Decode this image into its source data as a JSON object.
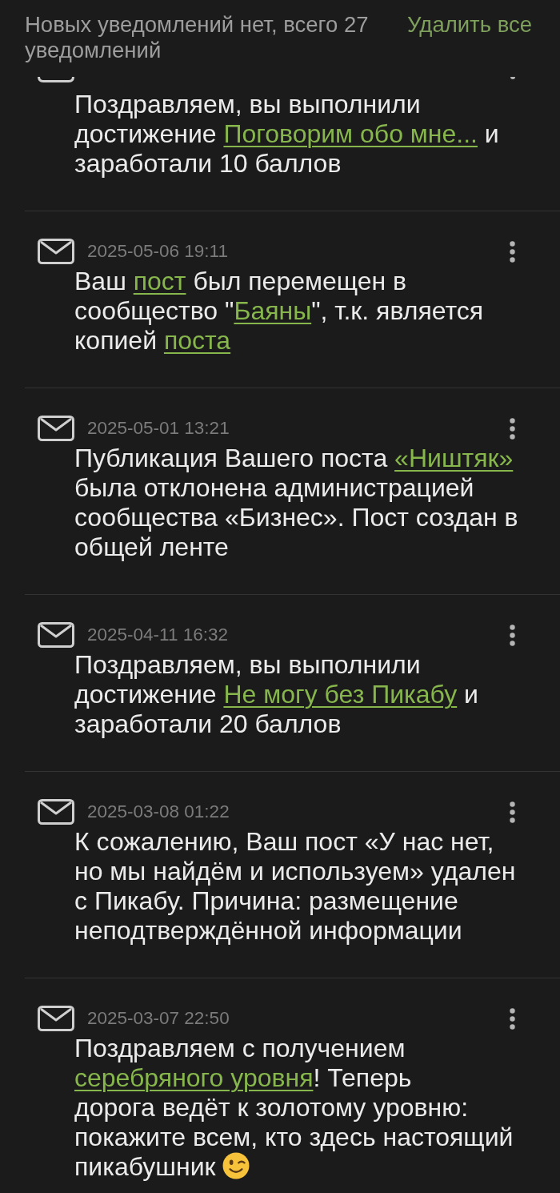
{
  "header": {
    "summary": "Новых уведомлений нет, всего 27 уведомлений",
    "delete_all": "Удалить все"
  },
  "notifications": [
    {
      "kind": "cut_off",
      "parts": [
        {
          "kind": "text",
          "text": "Поздравляем, вы выполнили достижение "
        },
        {
          "kind": "link",
          "text": "Поговорим обо мне..."
        },
        {
          "kind": "text",
          "text": " и заработали 10 баллов"
        }
      ]
    },
    {
      "kind": "full",
      "date": "2025-05-06 19:11",
      "parts": [
        {
          "kind": "text",
          "text": "Ваш "
        },
        {
          "kind": "link",
          "text": "пост"
        },
        {
          "kind": "text",
          "text": " был перемещен в сообщество \""
        },
        {
          "kind": "link",
          "text": "Баяны"
        },
        {
          "kind": "text",
          "text": "\", т.к. является копией "
        },
        {
          "kind": "link",
          "text": "поста"
        }
      ]
    },
    {
      "kind": "full",
      "date": "2025-05-01 13:21",
      "parts": [
        {
          "kind": "text",
          "text": "Публикация Вашего поста "
        },
        {
          "kind": "link",
          "text": "«Ништяк»"
        },
        {
          "kind": "text",
          "text": " была отклонена администрацией сообщества «Бизнес». Пост создан в общей ленте"
        }
      ]
    },
    {
      "kind": "full",
      "date": "2025-04-11 16:32",
      "parts": [
        {
          "kind": "text",
          "text": "Поздравляем, вы выполнили достижение "
        },
        {
          "kind": "link",
          "text": "Не могу без Пикабу"
        },
        {
          "kind": "text",
          "text": " и заработали 20 баллов"
        }
      ]
    },
    {
      "kind": "full",
      "date": "2025-03-08 01:22",
      "parts": [
        {
          "kind": "text",
          "text": "К сожалению, Ваш пост «У нас нет, но мы найдём и используем» удален с Пикабу. Причина: размещение неподтверждённой информации"
        }
      ]
    },
    {
      "kind": "full",
      "date": "2025-03-07 22:50",
      "parts": [
        {
          "kind": "text",
          "text": "Поздравляем с получением "
        },
        {
          "kind": "link",
          "text": "серебряного уровня"
        },
        {
          "kind": "text",
          "text": "! Теперь\nдорога ведёт к золотому уровню: покажите всем, кто здесь настоящий пикабушник "
        },
        {
          "kind": "emoji"
        }
      ]
    }
  ]
}
